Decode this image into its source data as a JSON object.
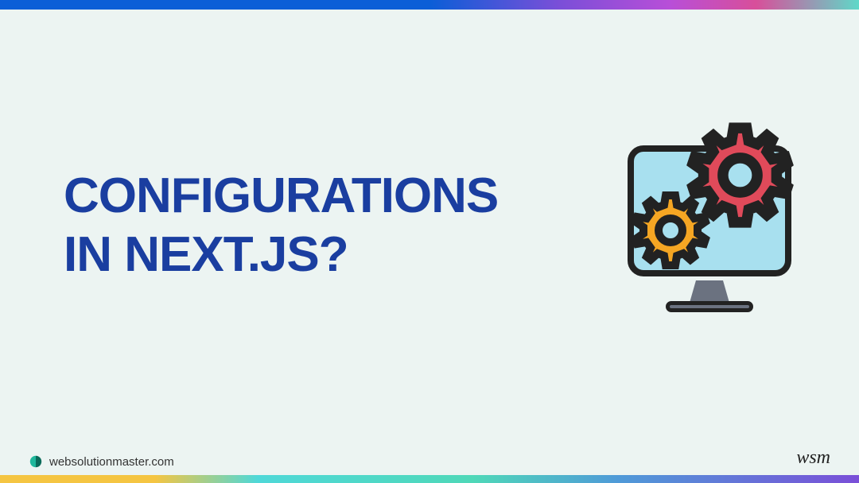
{
  "title": {
    "line1": "CONFIGURATIONS",
    "line2": "IN NEXT.JS?"
  },
  "footer": {
    "domain": "websolutionmaster.com"
  },
  "watermark": {
    "text": "wsm"
  },
  "colors": {
    "title": "#1a3ea0",
    "background": "#ecf4f2",
    "gear_big": "#e04a5a",
    "gear_small": "#f5a623",
    "monitor_screen": "#a8e0ef"
  }
}
